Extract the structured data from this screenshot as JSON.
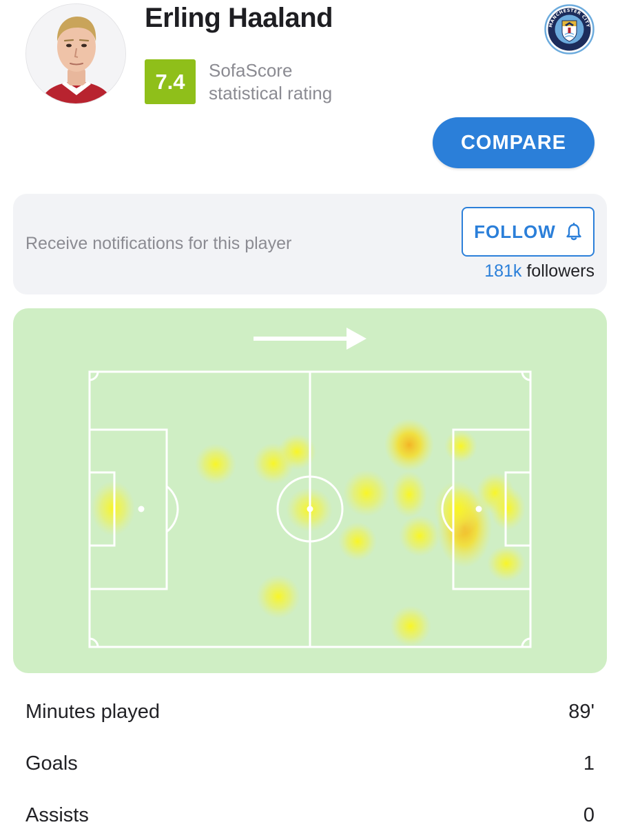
{
  "player": {
    "name": "Erling Haaland",
    "rating": "7.4",
    "rating_caption_line1": "SofaScore",
    "rating_caption_line2": "statistical rating",
    "club": "MANCHESTER CITY",
    "club_logo_icon": "manchester-city-crest-icon"
  },
  "compare": {
    "label": "COMPARE"
  },
  "follow": {
    "prompt": "Receive notifications for this player",
    "button_label": "FOLLOW",
    "button_icon": "bell-icon",
    "followers_count": "181k",
    "followers_label": " followers"
  },
  "heatmap": {
    "direction_icon": "attack-direction-arrow-icon",
    "pitch_color": "#cfeec4",
    "line_color": "#ffffff"
  },
  "stats": [
    {
      "label": "Minutes played",
      "value": "89'"
    },
    {
      "label": "Goals",
      "value": "1"
    },
    {
      "label": "Assists",
      "value": "0"
    }
  ],
  "colors": {
    "accent": "#2b7fd9",
    "rating_badge": "#8fbf1a",
    "muted_text": "#8b8b92",
    "card_bg": "#f2f3f6"
  }
}
